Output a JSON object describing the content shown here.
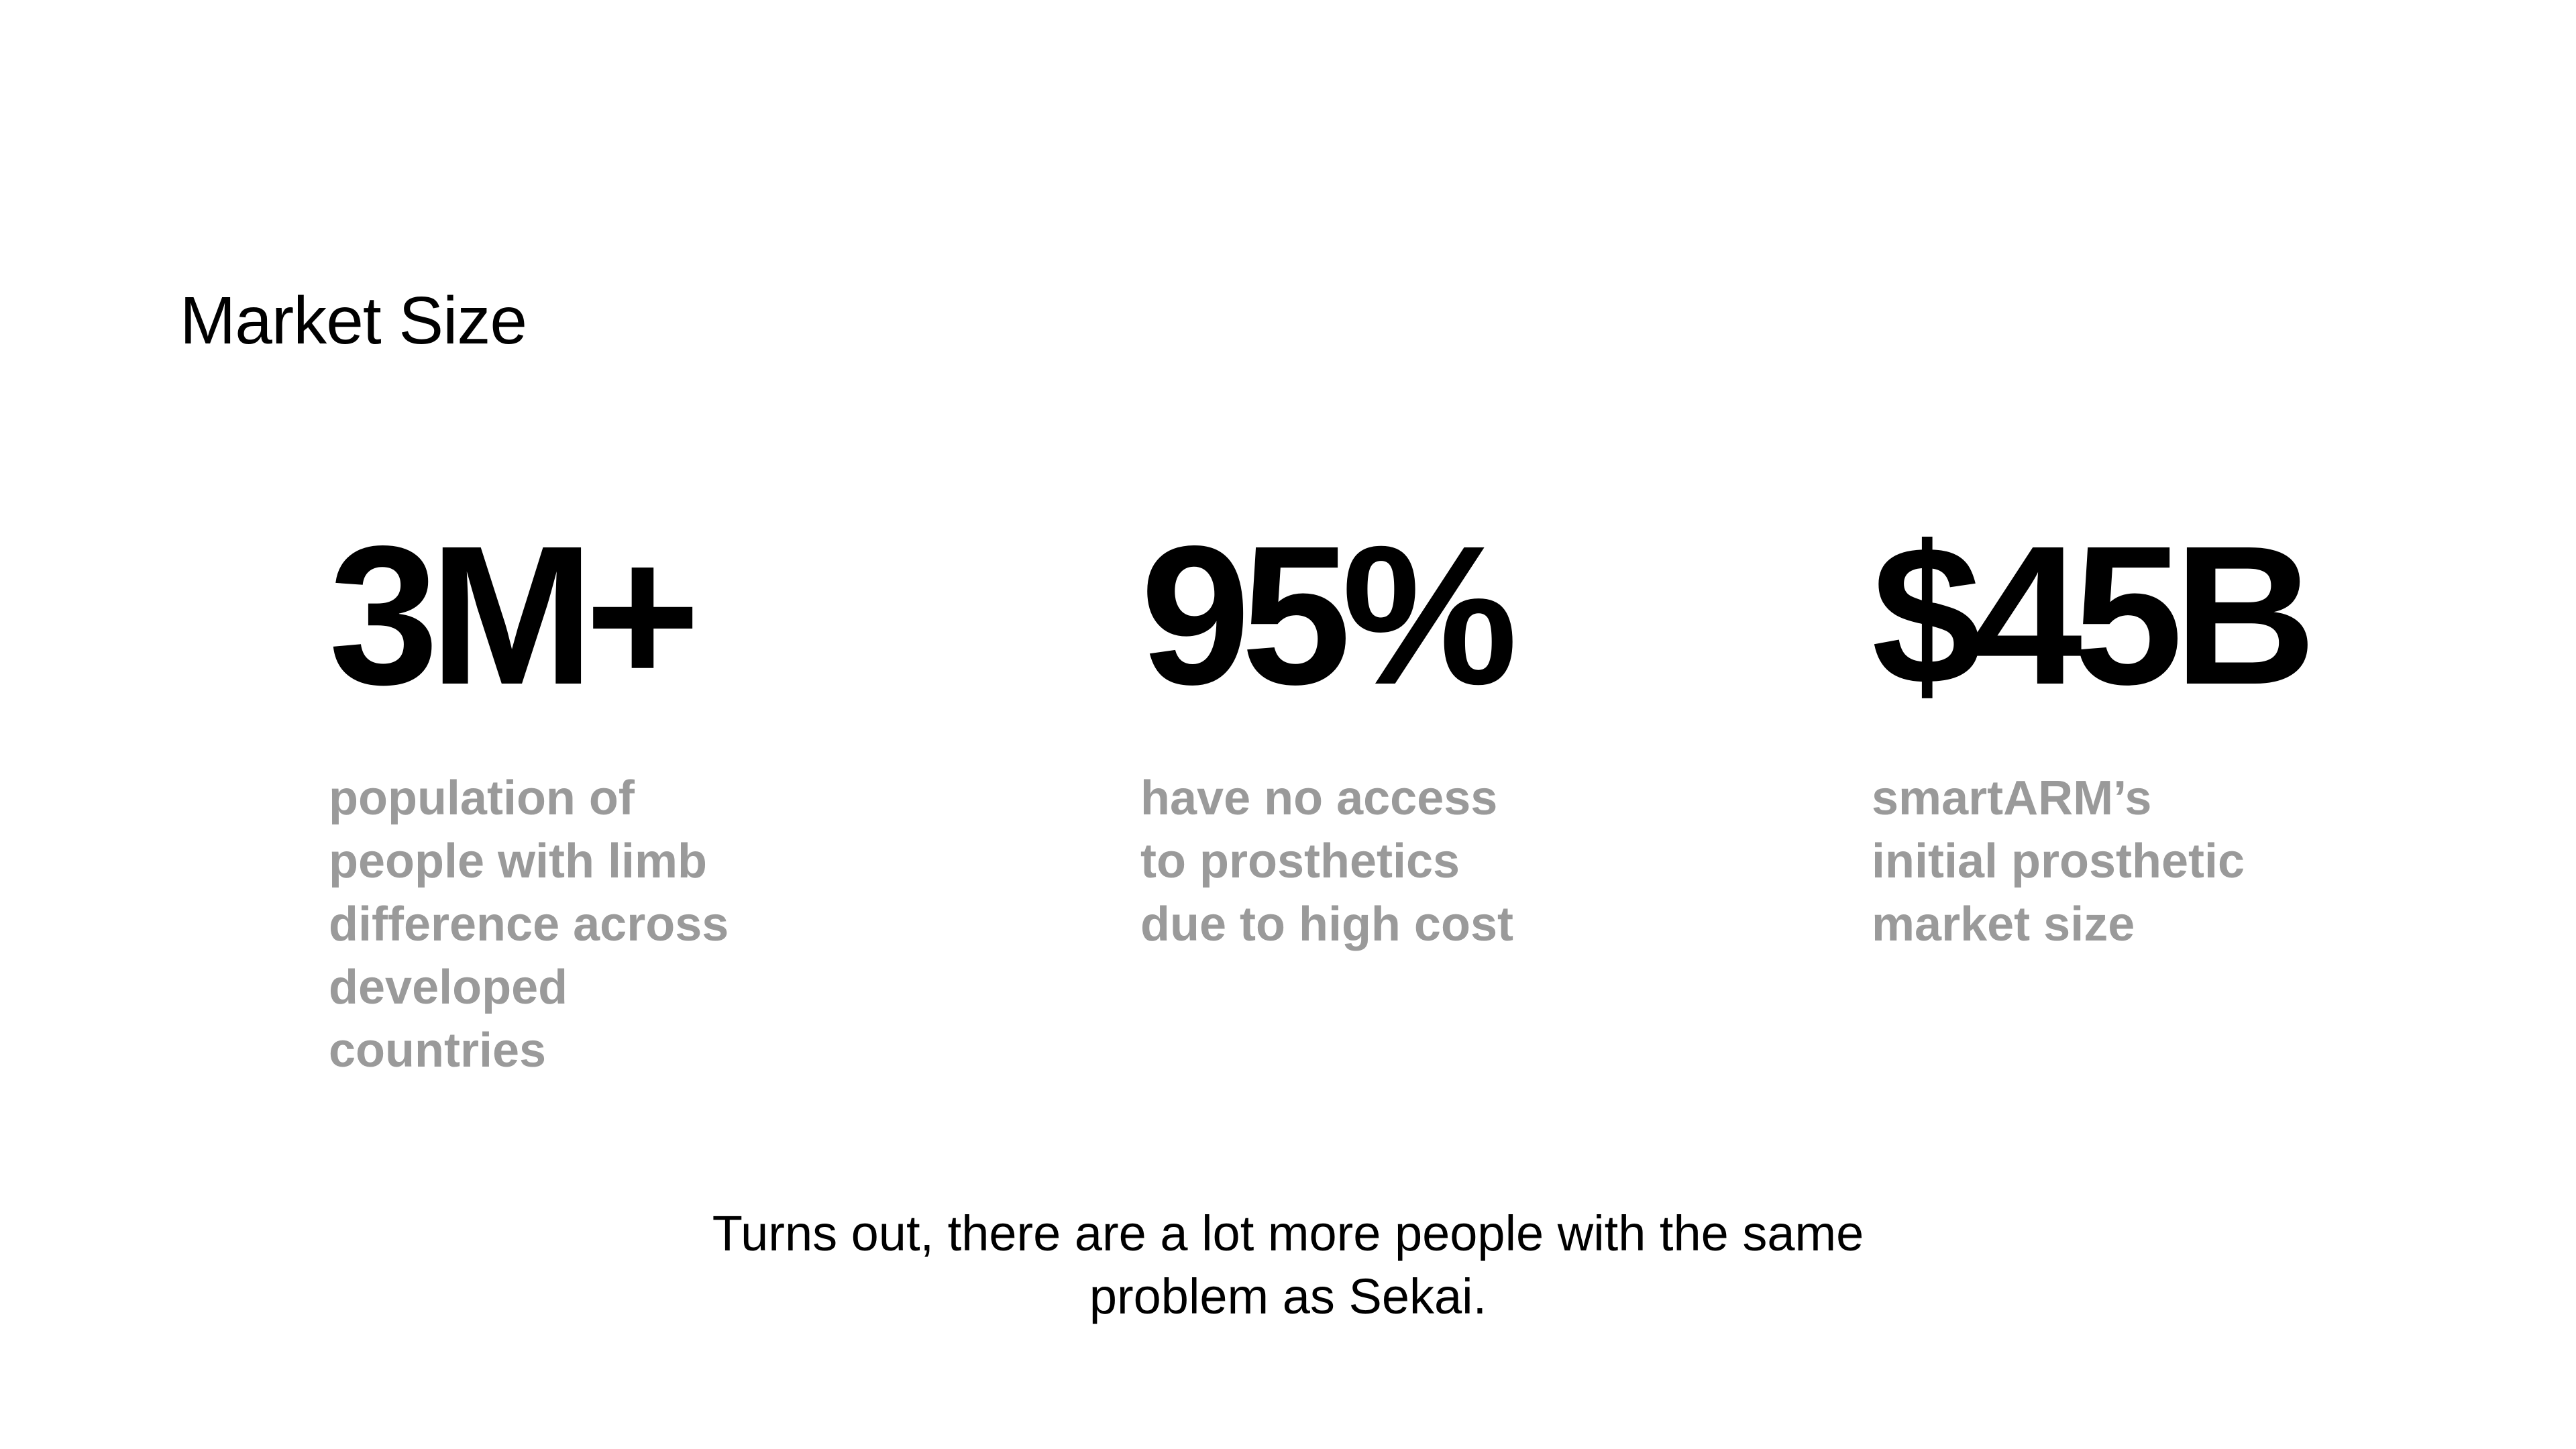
{
  "slide": {
    "title": "Market Size",
    "footer_note": "Turns out, there are a lot more people with the same\nproblem as Sekai."
  },
  "stats": [
    {
      "value": "3M+",
      "caption": "population of\npeople with limb\ndifference across\ndeveloped\ncountries"
    },
    {
      "value": "95%",
      "caption": "have no access\nto prosthetics\ndue to high cost"
    },
    {
      "value": "$45B",
      "caption": "smartARM’s\ninitial prosthetic\nmarket size"
    }
  ],
  "colors": {
    "text": "#000000",
    "caption": "#9a9a9a",
    "background": "#ffffff"
  }
}
